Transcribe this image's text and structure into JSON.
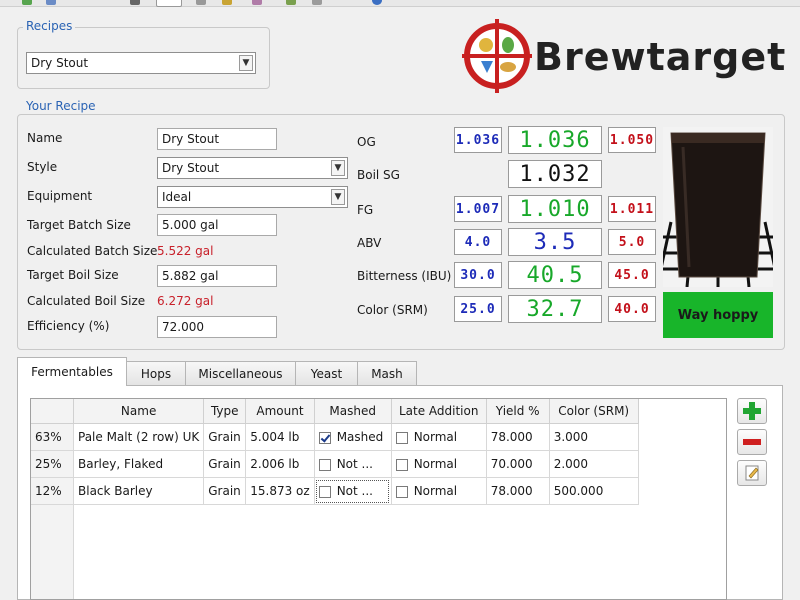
{
  "colors": {
    "accent": "#2a63b4",
    "red_text": "#c8202a",
    "lcd_blue": "#1d2bb8",
    "lcd_green": "#18a82a",
    "lcd_red": "#c3101a",
    "hoppy_bg": "#18b52a"
  },
  "recipes_group": {
    "title": "Recipes",
    "selected": "Dry Stout"
  },
  "logo": {
    "text": "Brewtarget"
  },
  "your_recipe": {
    "title": "Your Recipe",
    "name_label": "Name",
    "name_value": "Dry Stout",
    "style_label": "Style",
    "style_value": "Dry Stout",
    "equipment_label": "Equipment",
    "equipment_value": "Ideal",
    "target_batch_label": "Target Batch Size",
    "target_batch_value": "5.000 gal",
    "calc_batch_label": "Calculated Batch Size",
    "calc_batch_value": "5.522 gal",
    "target_boil_label": "Target Boil Size",
    "target_boil_value": "5.882 gal",
    "calc_boil_label": "Calculated Boil Size",
    "calc_boil_value": "6.272 gal",
    "efficiency_label": "Efficiency (%)",
    "efficiency_value": "72.000"
  },
  "stats": {
    "og": {
      "label": "OG",
      "min": "1.036",
      "value": "1.036",
      "max": "1.050"
    },
    "boil_sg": {
      "label": "Boil SG",
      "value": "1.032"
    },
    "fg": {
      "label": "FG",
      "min": "1.007",
      "value": "1.010",
      "max": "1.011"
    },
    "abv": {
      "label": "ABV",
      "min": "4.0",
      "value": "3.5",
      "max": "5.0"
    },
    "ibu": {
      "label": "Bitterness (IBU)",
      "min": "30.0",
      "value": "40.5",
      "max": "45.0"
    },
    "color": {
      "label": "Color (SRM)",
      "min": "25.0",
      "value": "32.7",
      "max": "40.0"
    }
  },
  "hoppy_badge": "Way hoppy",
  "tabs": [
    "Fermentables",
    "Hops",
    "Miscellaneous",
    "Yeast",
    "Mash"
  ],
  "fermentables": {
    "headers": [
      "Name",
      "Type",
      "Amount",
      "Mashed",
      "Late Addition",
      "Yield %",
      "Color (SRM)"
    ],
    "rows": [
      {
        "pct": "63%",
        "name": "Pale Malt (2 row) UK",
        "type": "Grain",
        "amount": "5.004 lb",
        "mashed_checked": true,
        "mashed": "Mashed",
        "late_checked": false,
        "late": "Normal",
        "yield": "78.000",
        "color": "3.000"
      },
      {
        "pct": "25%",
        "name": "Barley, Flaked",
        "type": "Grain",
        "amount": "2.006 lb",
        "mashed_checked": false,
        "mashed": "Not ...",
        "late_checked": false,
        "late": "Normal",
        "yield": "70.000",
        "color": "2.000"
      },
      {
        "pct": "12%",
        "name": "Black Barley",
        "type": "Grain",
        "amount": "15.873 oz",
        "mashed_checked": false,
        "mashed": "Not ...",
        "late_checked": false,
        "late": "Normal",
        "yield": "78.000",
        "color": "500.000"
      }
    ]
  },
  "icons": {
    "add": "plus-icon",
    "remove": "minus-icon",
    "edit": "edit-icon",
    "logo": "brewtarget-logo-icon",
    "beer": "beer-glass-icon"
  }
}
